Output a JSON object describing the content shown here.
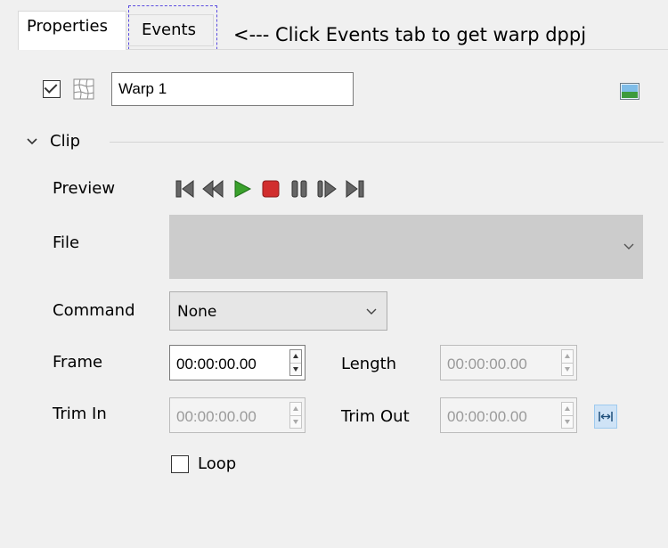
{
  "tabs": [
    {
      "label": "Properties"
    },
    {
      "label": "Events"
    }
  ],
  "annotation": "<--- Click Events tab to get warp dppj",
  "layer": {
    "enabled": true,
    "name": "Warp 1"
  },
  "clip": {
    "section_label": "Clip",
    "preview": {
      "label": "Preview",
      "buttons": [
        "skip-to-start-icon",
        "rewind-icon",
        "play-icon",
        "stop-icon",
        "pause-icon",
        "step-forward-icon",
        "skip-to-end-icon"
      ]
    },
    "file": {
      "label": "File",
      "value": ""
    },
    "command": {
      "label": "Command",
      "value": "None"
    },
    "frame": {
      "label": "Frame",
      "value": "00:00:00.00"
    },
    "length": {
      "label": "Length",
      "value": "00:00:00.00"
    },
    "trim_in": {
      "label": "Trim In",
      "value": "00:00:00.00"
    },
    "trim_out": {
      "label": "Trim Out",
      "value": "00:00:00.00"
    },
    "loop": {
      "label": "Loop",
      "checked": false
    }
  },
  "colors": {
    "play": "#3aa12c",
    "stop": "#d12d2d",
    "dashed_focus": "#5a4be0",
    "fit_button": "#cfe3f6"
  }
}
